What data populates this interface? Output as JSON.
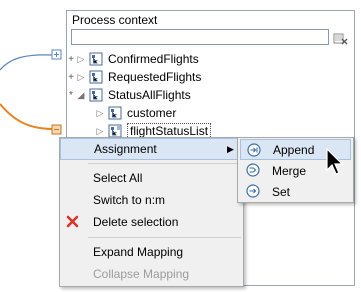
{
  "panel": {
    "title": "Process context",
    "search_value": "",
    "tree": [
      {
        "label": "ConfirmedFlights",
        "marker": "+",
        "twisty": "▷"
      },
      {
        "label": "RequestedFlights",
        "marker": "+",
        "twisty": "▷"
      },
      {
        "label": "StatusAllFlights",
        "marker": "*",
        "twisty": "◢"
      },
      {
        "label": "customer",
        "marker": "",
        "twisty": "▷"
      },
      {
        "label": "flightStatusList",
        "marker": "",
        "twisty": "▷"
      }
    ]
  },
  "context_menu": {
    "items": [
      {
        "label": "Assignment",
        "enabled": true
      },
      {
        "label": "Select All",
        "enabled": true
      },
      {
        "label": "Switch to n:m",
        "enabled": true
      },
      {
        "label": "Delete selection",
        "enabled": true,
        "icon": "delete-x-icon"
      },
      {
        "label": "Expand Mapping",
        "enabled": true
      },
      {
        "label": "Collapse Mapping",
        "enabled": false
      }
    ],
    "submenu_arrow": "▶"
  },
  "submenu": {
    "items": [
      {
        "label": "Append",
        "icon": "append-icon"
      },
      {
        "label": "Merge",
        "icon": "merge-icon"
      },
      {
        "label": "Set",
        "icon": "set-icon"
      }
    ]
  },
  "colors": {
    "mapping_line_orange": "#e8821e",
    "mapping_line_blue": "#5b86c0",
    "highlight": "#dbe6f4",
    "delete_red": "#d9332c"
  }
}
